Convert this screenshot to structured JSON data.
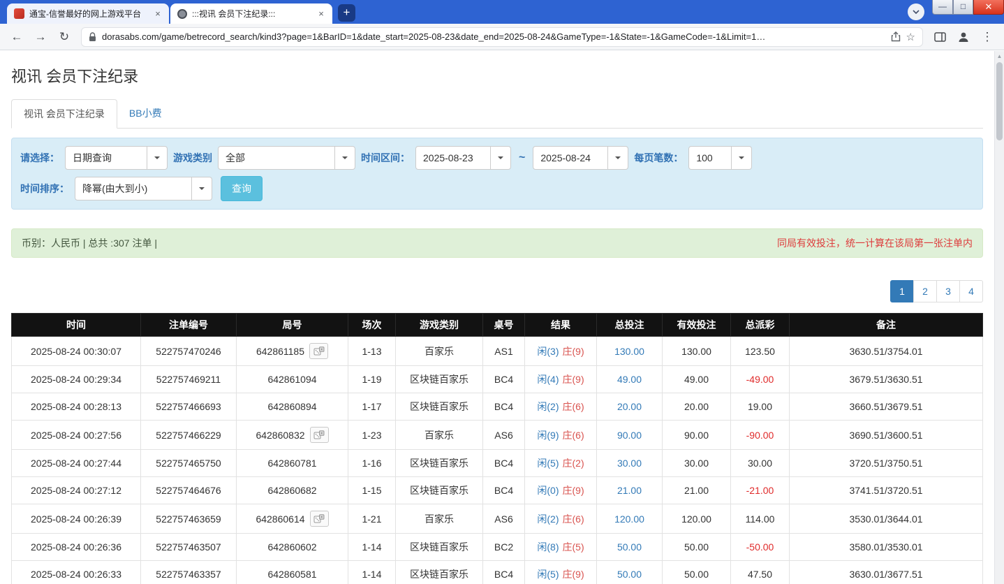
{
  "browser": {
    "tabs": [
      {
        "title": "通宝-信誉最好的网上游戏平台",
        "active": false
      },
      {
        "title": ":::视讯 会员下注纪录:::",
        "active": true
      }
    ],
    "new_tab_label": "+",
    "url": "dorasabs.com/game/betrecord_search/kind3?page=1&BarID=1&date_start=2025-08-23&date_end=2025-08-24&GameType=-1&State=-1&GameCode=-1&Limit=1…"
  },
  "page": {
    "title": "视讯 会员下注纪录",
    "tabs": [
      {
        "label": "视讯 会员下注纪录",
        "active": true
      },
      {
        "label": "BB小费",
        "active": false
      }
    ],
    "filters": {
      "labels": {
        "select": "请选择：",
        "game_type": "游戏类别",
        "date_range": "时间区间：",
        "tilde": "~",
        "page_size": "每页笔数：",
        "sort": "时间排序："
      },
      "values": {
        "select": "日期查询",
        "game_type": "全部",
        "date_start": "2025-08-23",
        "date_end": "2025-08-24",
        "page_size": "100",
        "sort": "降幂(由大到小)"
      },
      "search_button": "查询"
    },
    "summary": {
      "left": "币别：人民币 | 总共 :307 注单 |",
      "right": "同局有效投注，统一计算在该局第一张注单内"
    },
    "pagination": {
      "pages": [
        "1",
        "2",
        "3",
        "4"
      ],
      "active": 0
    },
    "table": {
      "headers": [
        "时间",
        "注单编号",
        "局号",
        "场次",
        "游戏类别",
        "桌号",
        "结果",
        "总投注",
        "有效投注",
        "总派彩",
        "备注"
      ],
      "rows": [
        {
          "time": "2025-08-24 00:30:07",
          "bet_id": "522757470246",
          "round_id": "642861185",
          "has_icon": true,
          "session": "1-13",
          "game": "百家乐",
          "table_no": "AS1",
          "player": "闲(3)",
          "banker": "庄(9)",
          "total_bet": "130.00",
          "valid_bet": "130.00",
          "payout": "123.50",
          "payout_neg": false,
          "remark": "3630.51/3754.01"
        },
        {
          "time": "2025-08-24 00:29:34",
          "bet_id": "522757469211",
          "round_id": "642861094",
          "has_icon": false,
          "session": "1-19",
          "game": "区块链百家乐",
          "table_no": "BC4",
          "player": "闲(4)",
          "banker": "庄(9)",
          "total_bet": "49.00",
          "valid_bet": "49.00",
          "payout": "-49.00",
          "payout_neg": true,
          "remark": "3679.51/3630.51"
        },
        {
          "time": "2025-08-24 00:28:13",
          "bet_id": "522757466693",
          "round_id": "642860894",
          "has_icon": false,
          "session": "1-17",
          "game": "区块链百家乐",
          "table_no": "BC4",
          "player": "闲(2)",
          "banker": "庄(6)",
          "total_bet": "20.00",
          "valid_bet": "20.00",
          "payout": "19.00",
          "payout_neg": false,
          "remark": "3660.51/3679.51"
        },
        {
          "time": "2025-08-24 00:27:56",
          "bet_id": "522757466229",
          "round_id": "642860832",
          "has_icon": true,
          "session": "1-23",
          "game": "百家乐",
          "table_no": "AS6",
          "player": "闲(9)",
          "banker": "庄(6)",
          "total_bet": "90.00",
          "valid_bet": "90.00",
          "payout": "-90.00",
          "payout_neg": true,
          "remark": "3690.51/3600.51"
        },
        {
          "time": "2025-08-24 00:27:44",
          "bet_id": "522757465750",
          "round_id": "642860781",
          "has_icon": false,
          "session": "1-16",
          "game": "区块链百家乐",
          "table_no": "BC4",
          "player": "闲(5)",
          "banker": "庄(2)",
          "total_bet": "30.00",
          "valid_bet": "30.00",
          "payout": "30.00",
          "payout_neg": false,
          "remark": "3720.51/3750.51"
        },
        {
          "time": "2025-08-24 00:27:12",
          "bet_id": "522757464676",
          "round_id": "642860682",
          "has_icon": false,
          "session": "1-15",
          "game": "区块链百家乐",
          "table_no": "BC4",
          "player": "闲(0)",
          "banker": "庄(9)",
          "total_bet": "21.00",
          "valid_bet": "21.00",
          "payout": "-21.00",
          "payout_neg": true,
          "remark": "3741.51/3720.51"
        },
        {
          "time": "2025-08-24 00:26:39",
          "bet_id": "522757463659",
          "round_id": "642860614",
          "has_icon": true,
          "session": "1-21",
          "game": "百家乐",
          "table_no": "AS6",
          "player": "闲(2)",
          "banker": "庄(6)",
          "total_bet": "120.00",
          "valid_bet": "120.00",
          "payout": "114.00",
          "payout_neg": false,
          "remark": "3530.01/3644.01"
        },
        {
          "time": "2025-08-24 00:26:36",
          "bet_id": "522757463507",
          "round_id": "642860602",
          "has_icon": false,
          "session": "1-14",
          "game": "区块链百家乐",
          "table_no": "BC2",
          "player": "闲(8)",
          "banker": "庄(5)",
          "total_bet": "50.00",
          "valid_bet": "50.00",
          "payout": "-50.00",
          "payout_neg": true,
          "remark": "3580.01/3530.01"
        },
        {
          "time": "2025-08-24 00:26:33",
          "bet_id": "522757463357",
          "round_id": "642860581",
          "has_icon": false,
          "session": "1-14",
          "game": "区块链百家乐",
          "table_no": "BC4",
          "player": "闲(5)",
          "banker": "庄(9)",
          "total_bet": "50.00",
          "valid_bet": "50.00",
          "payout": "47.50",
          "payout_neg": false,
          "remark": "3630.01/3677.51"
        }
      ]
    }
  }
}
